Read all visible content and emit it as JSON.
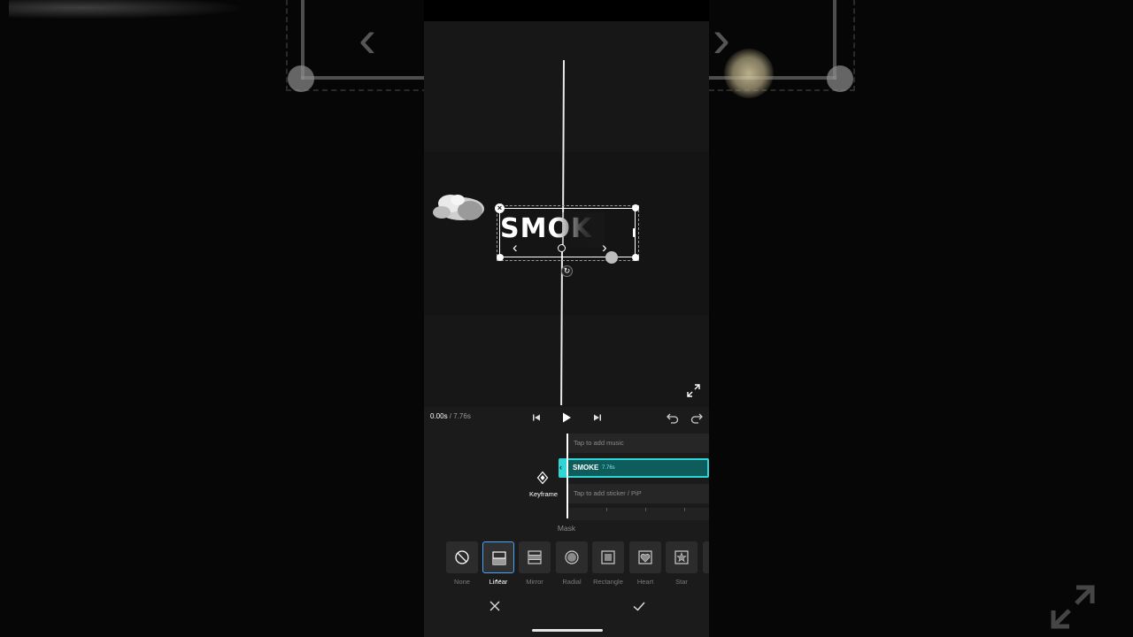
{
  "preview": {
    "text_overlay": "SMOK",
    "close_glyph": "×",
    "rotate_glyph": "↻",
    "chevron_left": "‹",
    "chevron_right": "›"
  },
  "playback": {
    "current_time": "0.00s",
    "total_time": " / 7.76s"
  },
  "timeline": {
    "music_track_label": "Tap to add music",
    "clip_title": "SMOKE",
    "clip_duration": "7.76s",
    "sticker_track_label": "Tap to add sticker / PiP",
    "keyframe_label": "Keyframe"
  },
  "mask": {
    "title": "Mask",
    "selected": "Linear",
    "options": [
      {
        "label": "None",
        "icon": "none-icon"
      },
      {
        "label": "Linear",
        "icon": "linear-icon"
      },
      {
        "label": "Mirror",
        "icon": "mirror-icon"
      },
      {
        "label": "Radial",
        "icon": "radial-icon"
      },
      {
        "label": "Rectangle",
        "icon": "rectangle-icon"
      },
      {
        "label": "Heart",
        "icon": "heart-icon"
      },
      {
        "label": "Star",
        "icon": "star-icon"
      }
    ]
  },
  "colors": {
    "accent_clip": "#2ed6d6",
    "selection_blue": "#4aa3ff",
    "panel_bg": "#1b1b1b"
  }
}
